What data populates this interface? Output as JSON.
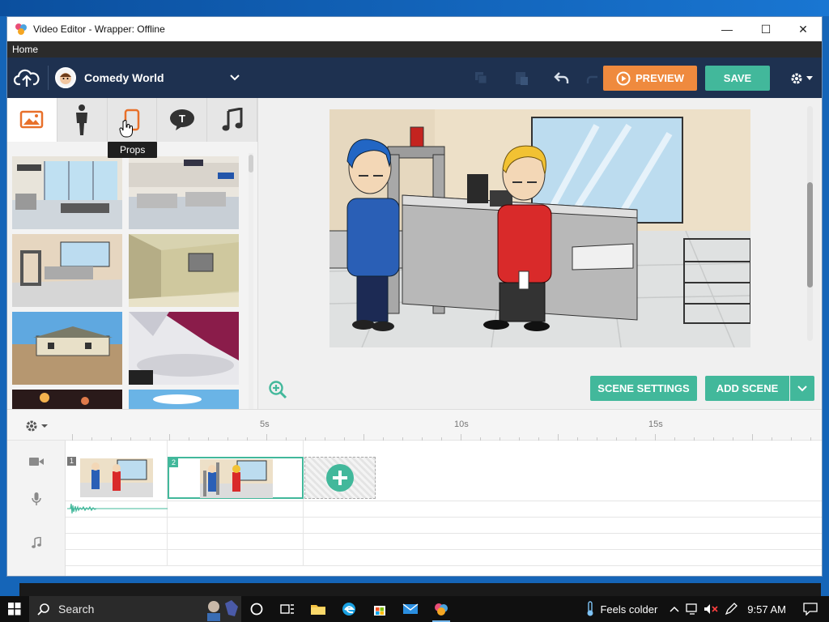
{
  "window": {
    "title": "Video Editor - Wrapper: Offline",
    "minimize": "—",
    "maximize": "☐",
    "close": "✕"
  },
  "menu": {
    "home": "Home"
  },
  "toolbar": {
    "theme_name": "Comedy World",
    "preview_label": "PREVIEW",
    "save_label": "SAVE"
  },
  "asset_tabs": [
    {
      "name": "backgrounds",
      "icon": "image-icon",
      "active": true
    },
    {
      "name": "characters",
      "icon": "person-icon",
      "active": false
    },
    {
      "name": "props",
      "icon": "phone-icon",
      "active": false
    },
    {
      "name": "text",
      "icon": "speech-bubble-icon",
      "active": false
    },
    {
      "name": "sound",
      "icon": "music-note-icon",
      "active": false
    }
  ],
  "tooltip": {
    "text": "Props"
  },
  "stage": {
    "scene_settings_label": "SCENE SETTINGS",
    "add_scene_label": "ADD SCENE"
  },
  "timeline": {
    "ticks": [
      "5s",
      "10s",
      "15s"
    ],
    "scenes": [
      {
        "number": "1",
        "selected": false
      },
      {
        "number": "2",
        "selected": true
      }
    ]
  },
  "taskbar": {
    "search_placeholder": "Search",
    "weather": "Feels colder",
    "time": "9:57 AM"
  },
  "colors": {
    "accent_green": "#42b89b",
    "preview_orange": "#ef8a3e",
    "topbar_navy": "#1e3150",
    "tab_orange": "#e8702a"
  }
}
